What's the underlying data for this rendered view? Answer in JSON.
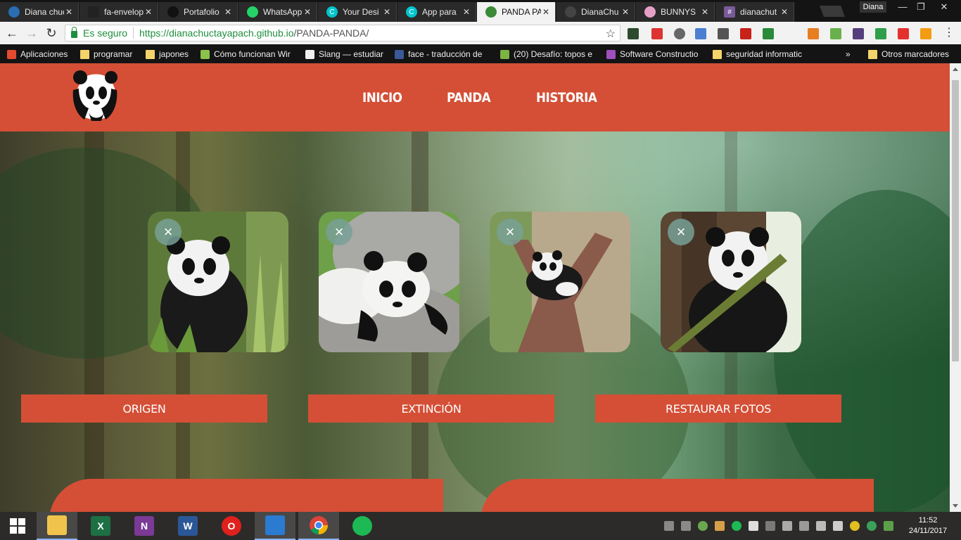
{
  "browser": {
    "tabs": [
      {
        "title": "Diana chuc",
        "fav_color": "#2a6db0"
      },
      {
        "title": "fa-envelop",
        "fav_color": "#222222"
      },
      {
        "title": "Portafolio",
        "fav_color": "#111111"
      },
      {
        "title": "WhatsApp",
        "fav_color": "#25d366"
      },
      {
        "title": "Your Desi",
        "fav_color": "#00c4cc"
      },
      {
        "title": "App para",
        "fav_color": "#00c4cc"
      },
      {
        "title": "PANDA PA",
        "fav_color": "#3a8a3a",
        "active": true
      },
      {
        "title": "DianaChu",
        "fav_color": "#444444"
      },
      {
        "title": "BUNNYS",
        "fav_color": "#e6a0c8"
      },
      {
        "title": "dianachut",
        "fav_color": "#7a5a9a"
      }
    ],
    "profile_name": "Diana",
    "security_label": "Es seguro",
    "url_host": "https://dianachuctayapach.github.io",
    "url_path": "/PANDA-PANDA/",
    "bookmarks": [
      {
        "label": "Aplicaciones",
        "color": "#e44a2f"
      },
      {
        "label": "programar",
        "color": "#f4d46a"
      },
      {
        "label": "japones",
        "color": "#f4d46a"
      },
      {
        "label": "Cómo funcionan Wir",
        "color": "#8bc34a"
      },
      {
        "label": "Slang — estudiar",
        "color": "#f0f0f0"
      },
      {
        "label": "face - traducción de",
        "color": "#3b5998"
      },
      {
        "label": "(20) Desafío: topos e",
        "color": "#7cb342"
      },
      {
        "label": "Software Constructio",
        "color": "#a04fbf"
      },
      {
        "label": "seguridad informatic",
        "color": "#f4d46a"
      }
    ],
    "more_bookmarks_label": "»",
    "other_bookmarks_label": "Otros marcadores"
  },
  "site": {
    "nav": [
      "INICIO",
      "PANDA",
      "HISTORIA"
    ],
    "photo_close_glyph": "×",
    "buttons": [
      "ORIGEN",
      "EXTINCIÓN",
      "RESTAURAR FOTOS"
    ],
    "brand_color": "#d44f36"
  },
  "taskbar": {
    "apps": [
      {
        "name": "explorer",
        "label": ""
      },
      {
        "name": "excel",
        "label": "X",
        "color": "#1d7044"
      },
      {
        "name": "onenote",
        "label": "N",
        "color": "#7b3a96"
      },
      {
        "name": "word",
        "label": "W",
        "color": "#2b5797"
      },
      {
        "name": "opera",
        "label": "O",
        "color": "#e0201c"
      },
      {
        "name": "vscode",
        "label": "",
        "color": "#2b7bd0"
      },
      {
        "name": "chrome",
        "label": "",
        "active": true
      },
      {
        "name": "spotify",
        "label": "",
        "color": "#1db954"
      }
    ],
    "time": "11:52",
    "date": "24/11/2017"
  }
}
